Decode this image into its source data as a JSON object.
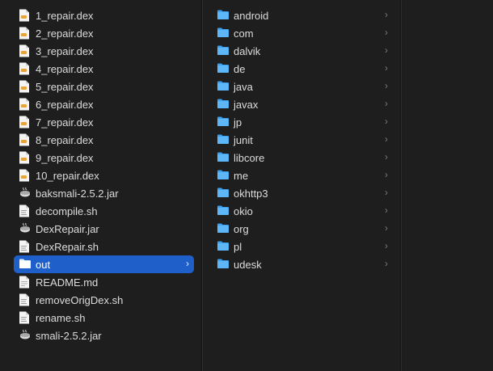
{
  "window": {
    "theme": "dark"
  },
  "colors": {
    "background": "#1e1e1e",
    "selection": "#1f5fc9",
    "folder": "#3aa0f0",
    "text": "#dcdcdc"
  },
  "columns": [
    {
      "items": [
        {
          "name": "1_repair.dex",
          "icon": "dex-file-icon",
          "selected": false,
          "folder": false
        },
        {
          "name": "2_repair.dex",
          "icon": "dex-file-icon",
          "selected": false,
          "folder": false
        },
        {
          "name": "3_repair.dex",
          "icon": "dex-file-icon",
          "selected": false,
          "folder": false
        },
        {
          "name": "4_repair.dex",
          "icon": "dex-file-icon",
          "selected": false,
          "folder": false
        },
        {
          "name": "5_repair.dex",
          "icon": "dex-file-icon",
          "selected": false,
          "folder": false
        },
        {
          "name": "6_repair.dex",
          "icon": "dex-file-icon",
          "selected": false,
          "folder": false
        },
        {
          "name": "7_repair.dex",
          "icon": "dex-file-icon",
          "selected": false,
          "folder": false
        },
        {
          "name": "8_repair.dex",
          "icon": "dex-file-icon",
          "selected": false,
          "folder": false
        },
        {
          "name": "9_repair.dex",
          "icon": "dex-file-icon",
          "selected": false,
          "folder": false
        },
        {
          "name": "10_repair.dex",
          "icon": "dex-file-icon",
          "selected": false,
          "folder": false
        },
        {
          "name": "baksmali-2.5.2.jar",
          "icon": "jar-file-icon",
          "selected": false,
          "folder": false
        },
        {
          "name": "decompile.sh",
          "icon": "script-file-icon",
          "selected": false,
          "folder": false
        },
        {
          "name": "DexRepair.jar",
          "icon": "jar-file-icon",
          "selected": false,
          "folder": false
        },
        {
          "name": "DexRepair.sh",
          "icon": "script-file-icon",
          "selected": false,
          "folder": false
        },
        {
          "name": "out",
          "icon": "folder-icon",
          "selected": true,
          "folder": true
        },
        {
          "name": "README.md",
          "icon": "document-file-icon",
          "selected": false,
          "folder": false
        },
        {
          "name": "removeOrigDex.sh",
          "icon": "script-file-icon",
          "selected": false,
          "folder": false
        },
        {
          "name": "rename.sh",
          "icon": "script-file-icon",
          "selected": false,
          "folder": false
        },
        {
          "name": "smali-2.5.2.jar",
          "icon": "jar-file-icon",
          "selected": false,
          "folder": false
        }
      ]
    },
    {
      "items": [
        {
          "name": "android",
          "icon": "folder-icon",
          "selected": false,
          "folder": true
        },
        {
          "name": "com",
          "icon": "folder-icon",
          "selected": false,
          "folder": true
        },
        {
          "name": "dalvik",
          "icon": "folder-icon",
          "selected": false,
          "folder": true
        },
        {
          "name": "de",
          "icon": "folder-icon",
          "selected": false,
          "folder": true
        },
        {
          "name": "java",
          "icon": "folder-icon",
          "selected": false,
          "folder": true
        },
        {
          "name": "javax",
          "icon": "folder-icon",
          "selected": false,
          "folder": true
        },
        {
          "name": "jp",
          "icon": "folder-icon",
          "selected": false,
          "folder": true
        },
        {
          "name": "junit",
          "icon": "folder-icon",
          "selected": false,
          "folder": true
        },
        {
          "name": "libcore",
          "icon": "folder-icon",
          "selected": false,
          "folder": true
        },
        {
          "name": "me",
          "icon": "folder-icon",
          "selected": false,
          "folder": true
        },
        {
          "name": "okhttp3",
          "icon": "folder-icon",
          "selected": false,
          "folder": true
        },
        {
          "name": "okio",
          "icon": "folder-icon",
          "selected": false,
          "folder": true
        },
        {
          "name": "org",
          "icon": "folder-icon",
          "selected": false,
          "folder": true
        },
        {
          "name": "pl",
          "icon": "folder-icon",
          "selected": false,
          "folder": true
        },
        {
          "name": "udesk",
          "icon": "folder-icon",
          "selected": false,
          "folder": true
        }
      ]
    }
  ]
}
